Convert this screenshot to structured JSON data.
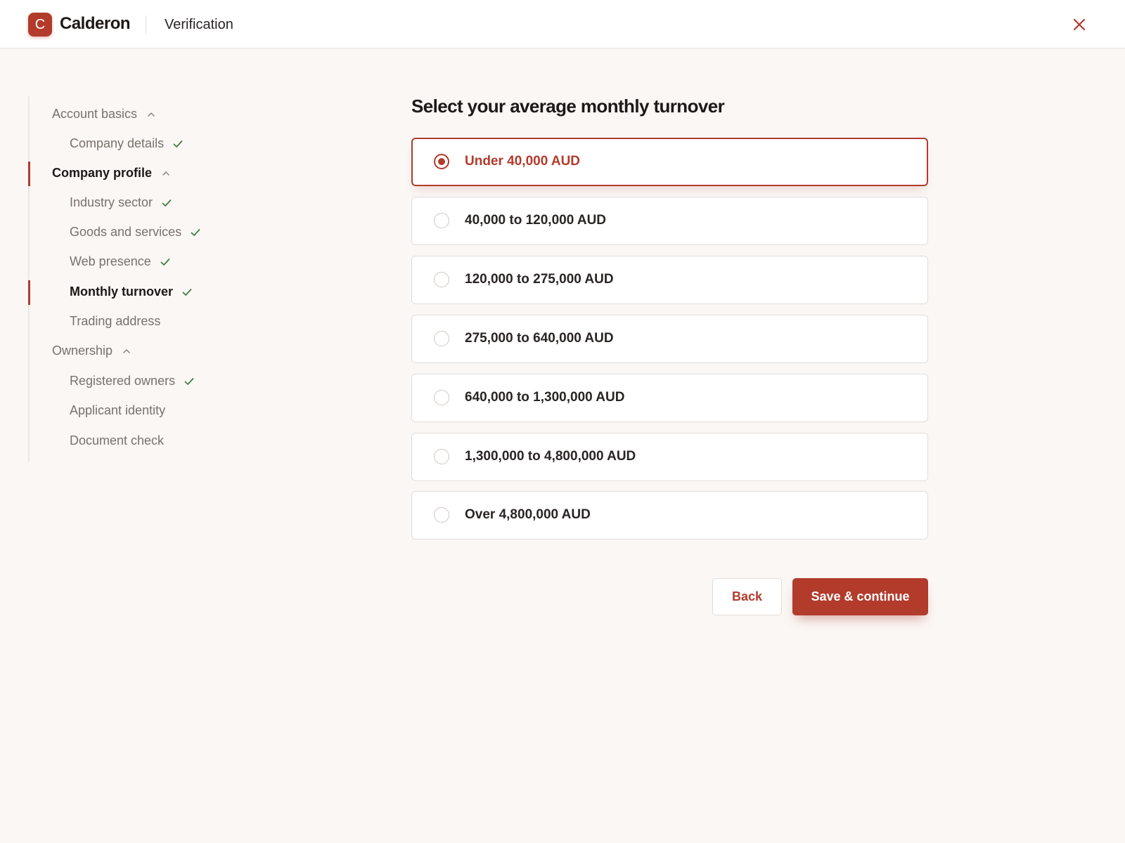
{
  "header": {
    "logo_letter": "C",
    "brand": "Calderon",
    "section": "Verification"
  },
  "sidebar": {
    "groups": [
      {
        "label": "Account basics",
        "items": [
          {
            "label": "Company details",
            "complete": true
          }
        ]
      },
      {
        "label": "Company profile",
        "items": [
          {
            "label": "Industry sector",
            "complete": true
          },
          {
            "label": "Goods and services",
            "complete": true
          },
          {
            "label": "Web presence",
            "complete": true
          },
          {
            "label": "Monthly turnover",
            "complete": true
          },
          {
            "label": "Trading address",
            "complete": false
          }
        ]
      },
      {
        "label": "Ownership",
        "items": [
          {
            "label": "Registered owners",
            "complete": true
          },
          {
            "label": "Applicant identity",
            "complete": false
          },
          {
            "label": "Document check",
            "complete": false
          }
        ]
      }
    ],
    "active_group": "Company profile",
    "active_item": "Monthly turnover"
  },
  "main": {
    "heading": "Select your average monthly turnover",
    "options": [
      {
        "label": "Under 40,000 AUD",
        "selected": true
      },
      {
        "label": "40,000 to 120,000 AUD",
        "selected": false
      },
      {
        "label": "120,000 to 275,000 AUD",
        "selected": false
      },
      {
        "label": "275,000 to 640,000 AUD",
        "selected": false
      },
      {
        "label": "640,000 to 1,300,000 AUD",
        "selected": false
      },
      {
        "label": "1,300,000 to 4,800,000 AUD",
        "selected": false
      },
      {
        "label": "Over 4,800,000 AUD",
        "selected": false
      }
    ],
    "back_label": "Back",
    "save_label": "Save & continue"
  },
  "colors": {
    "accent": "#b23b2c",
    "check": "#3f7d46",
    "background": "#faf7f5"
  },
  "icons": {
    "close": "close-icon",
    "chevron": "chevron-up-icon",
    "check": "check-icon"
  }
}
